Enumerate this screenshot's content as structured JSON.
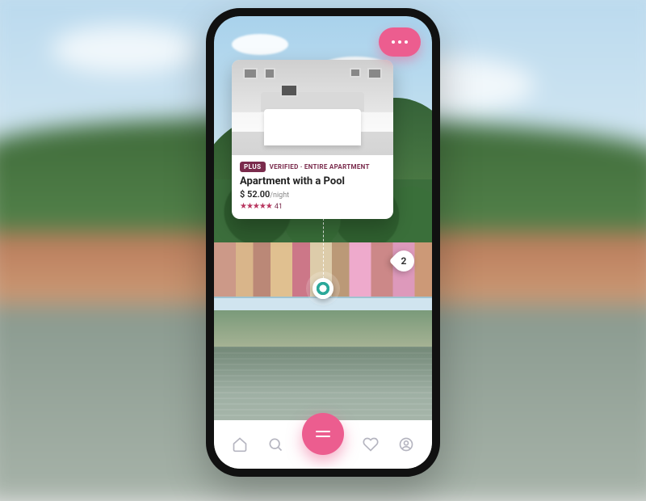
{
  "listing": {
    "plus_badge": "PLUS",
    "verified_line": "VERIFIED · ENTIRE APARTMENT",
    "title": "Apartment with a Pool",
    "currency": "$",
    "price": "52.00",
    "per_label": "/night",
    "stars": "★★★★★",
    "review_count": "41"
  },
  "map": {
    "cluster_count": "2"
  },
  "colors": {
    "accent": "#ec5d8f",
    "badge": "#7a2b4c"
  }
}
